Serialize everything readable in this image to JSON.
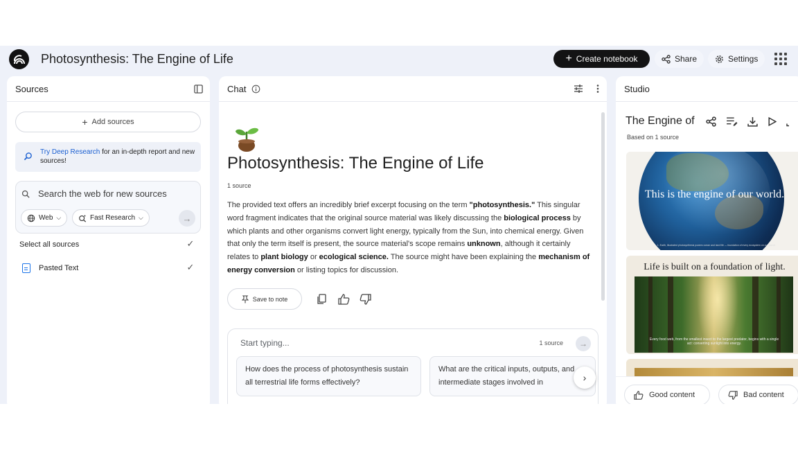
{
  "header": {
    "title": "Photosynthesis: The Engine of Life",
    "create_label": "Create notebook",
    "share_label": "Share",
    "settings_label": "Settings"
  },
  "sources": {
    "title": "Sources",
    "add_label": "Add sources",
    "deep_link": "Try Deep Research",
    "deep_rest": " for an in-depth report and new sources!",
    "search_placeholder": "Search the web for new sources",
    "web_chip": "Web",
    "fast_chip": "Fast Research",
    "select_all": "Select all sources",
    "items": [
      {
        "label": "Pasted Text",
        "checked": true
      }
    ]
  },
  "chat": {
    "title": "Chat",
    "notebook_title": "Photosynthesis: The Engine of Life",
    "source_count": "1 source",
    "body": [
      {
        "t": "The provided text offers an incredibly brief excerpt focusing on the term "
      },
      {
        "t": "\"photosynthesis.\"",
        "b": true
      },
      {
        "t": " This singular word fragment indicates that the original source material was likely discussing the "
      },
      {
        "t": "biological process",
        "b": true
      },
      {
        "t": " by which plants and other organisms convert light energy, typically from the Sun, into chemical energy. Given that only the term itself is present, the source material's scope remains "
      },
      {
        "t": "unknown",
        "b": true
      },
      {
        "t": ", although it certainly relates to "
      },
      {
        "t": "plant biology",
        "b": true
      },
      {
        "t": " or "
      },
      {
        "t": "ecological science.",
        "b": true
      },
      {
        "t": " The source might have been explaining the "
      },
      {
        "t": "mechanism of energy conversion",
        "b": true
      },
      {
        "t": " or listing topics for discussion."
      }
    ],
    "save_label": "Save to note",
    "input_placeholder": "Start typing...",
    "input_source_count": "1 source",
    "suggestions": [
      "How does the process of photosynthesis sustain all terrestrial life forms effectively?",
      "What are the critical inputs, outputs, and intermediate stages involved in photosynthesis?"
    ]
  },
  "studio": {
    "title": "Studio",
    "item_title": "The Engine of",
    "based_on": "Based on 1 source",
    "slides": [
      {
        "text": "This is the engine of our world.",
        "caption": "1.  Earth, illustrated photosynthesis powers ocean and land life — foundation of every ecosystem on our planet"
      },
      {
        "title": "Life is built on a foundation of light.",
        "caption": "Every food web, from the smallest insect to the largest predator, begins with a single act: converting sunlight into energy."
      }
    ],
    "good_label": "Good content",
    "bad_label": "Bad content"
  }
}
